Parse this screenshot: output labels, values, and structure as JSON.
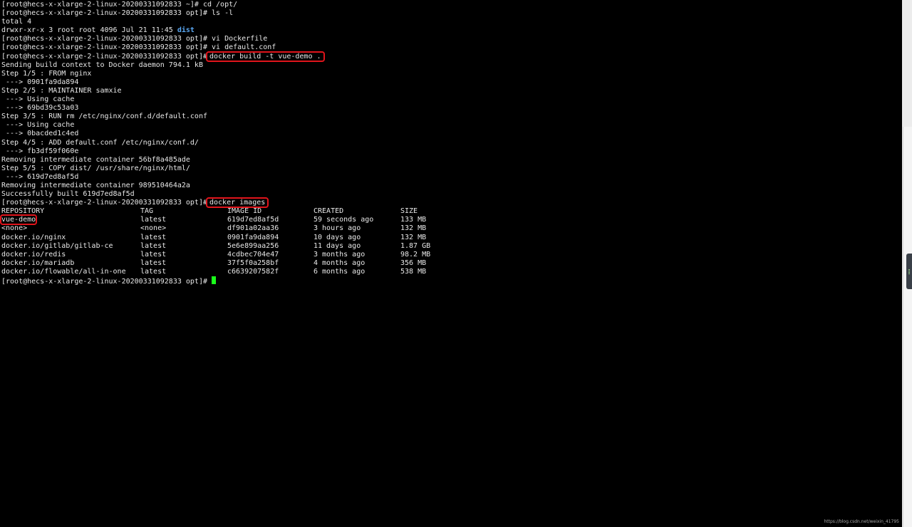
{
  "terminal": {
    "lines": [
      "[root@hecs-x-xlarge-2-linux-20200331092833 ~]# cd /opt/",
      "[root@hecs-x-xlarge-2-linux-20200331092833 opt]# ls -l",
      "total 4",
      "drwxr-xr-x 3 root root 4096 Jul 21 11:45 ",
      "[root@hecs-x-xlarge-2-linux-20200331092833 opt]# vi Dockerfile",
      "[root@hecs-x-xlarge-2-linux-20200331092833 opt]# vi default.conf",
      "[root@hecs-x-xlarge-2-linux-20200331092833 opt]#",
      "Sending build context to Docker daemon 794.1 kB",
      "Step 1/5 : FROM nginx",
      " ---> 0901fa9da894",
      "Step 2/5 : MAINTAINER samxie",
      " ---> Using cache",
      " ---> 69bd39c53a03",
      "Step 3/5 : RUN rm /etc/nginx/conf.d/default.conf",
      " ---> Using cache",
      " ---> 0bacded1c4ed",
      "Step 4/5 : ADD default.conf /etc/nginx/conf.d/",
      " ---> fb3df59f060e",
      "Removing intermediate container 56bf8a485ade",
      "Step 5/5 : COPY dist/ /usr/share/nginx/html/",
      " ---> 619d7ed8af5d",
      "Removing intermediate container 989510464a2a",
      "Successfully built 619d7ed8af5d",
      "[root@hecs-x-xlarge-2-linux-20200331092833 opt]#"
    ],
    "dist_label": "dist",
    "build_command": "docker build -t vue-demo .",
    "images_command": "docker images",
    "final_prompt": "[root@hecs-x-xlarge-2-linux-20200331092833 opt]#",
    "table": {
      "headers": [
        "REPOSITORY",
        "TAG",
        "IMAGE ID",
        "CREATED",
        "SIZE"
      ],
      "rows": [
        [
          "vue-demo",
          "latest",
          "619d7ed8af5d",
          "59 seconds ago",
          "133 MB"
        ],
        [
          "<none>",
          "<none>",
          "df901a02aa36",
          "3 hours ago",
          "132 MB"
        ],
        [
          "docker.io/nginx",
          "latest",
          "0901fa9da894",
          "10 days ago",
          "132 MB"
        ],
        [
          "docker.io/gitlab/gitlab-ce",
          "latest",
          "5e6e899aa256",
          "11 days ago",
          "1.87 GB"
        ],
        [
          "docker.io/redis",
          "latest",
          "4cdbec704e47",
          "3 months ago",
          "98.2 MB"
        ],
        [
          "docker.io/mariadb",
          "latest",
          "37f5f0a258bf",
          "4 months ago",
          "356 MB"
        ],
        [
          "docker.io/flowable/all-in-one",
          "latest",
          "c6639207582f",
          "6 months ago",
          "538 MB"
        ]
      ]
    }
  },
  "colors": {
    "background": "#000000",
    "text": "#e8e8e8",
    "highlight_box": "#e0141b",
    "cursor": "#1aff1a",
    "directory": "#5aa9f5"
  },
  "watermark": "https://blog.csdn.net/weixin_41795"
}
